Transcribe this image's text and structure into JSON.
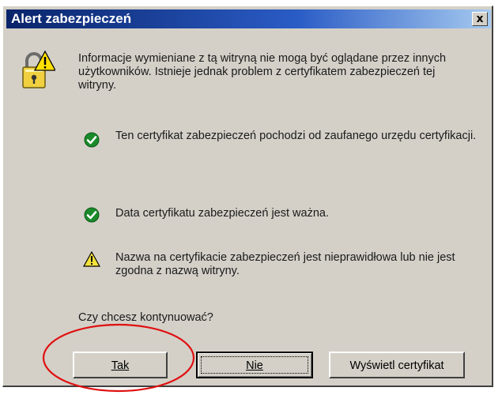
{
  "window": {
    "title": "Alert zabezpieczeń",
    "close_label": "x"
  },
  "intro_text": "Informacje wymieniane z tą witryną nie mogą być oglądane przez innych użytkowników. Istnieje jednak problem z certyfikatem zabezpieczeń tej witryny.",
  "checks": [
    {
      "status": "ok",
      "icon": "green-check-icon",
      "text": "Ten certyfikat zabezpieczeń pochodzi od zaufanego urzędu certyfikacji."
    },
    {
      "status": "ok",
      "icon": "green-check-icon",
      "text": "Data certyfikatu zabezpieczeń jest ważna."
    },
    {
      "status": "warning",
      "icon": "warning-triangle-icon",
      "text": "Nazwa na certyfikacie zabezpieczeń jest nieprawidłowa lub nie jest zgodna z nazwą witryny."
    }
  ],
  "question": "Czy chcesz kontynuować?",
  "buttons": {
    "yes": "Tak",
    "no": "Nie",
    "view": "Wyświetl certyfikat"
  },
  "colors": {
    "dialog_bg": "#d4d0c8",
    "title_start": "#0a246a",
    "title_end": "#a6caf0",
    "check_green": "#1a8a2a",
    "warning_yellow": "#f5e23a",
    "annotation_red": "#e01010"
  }
}
